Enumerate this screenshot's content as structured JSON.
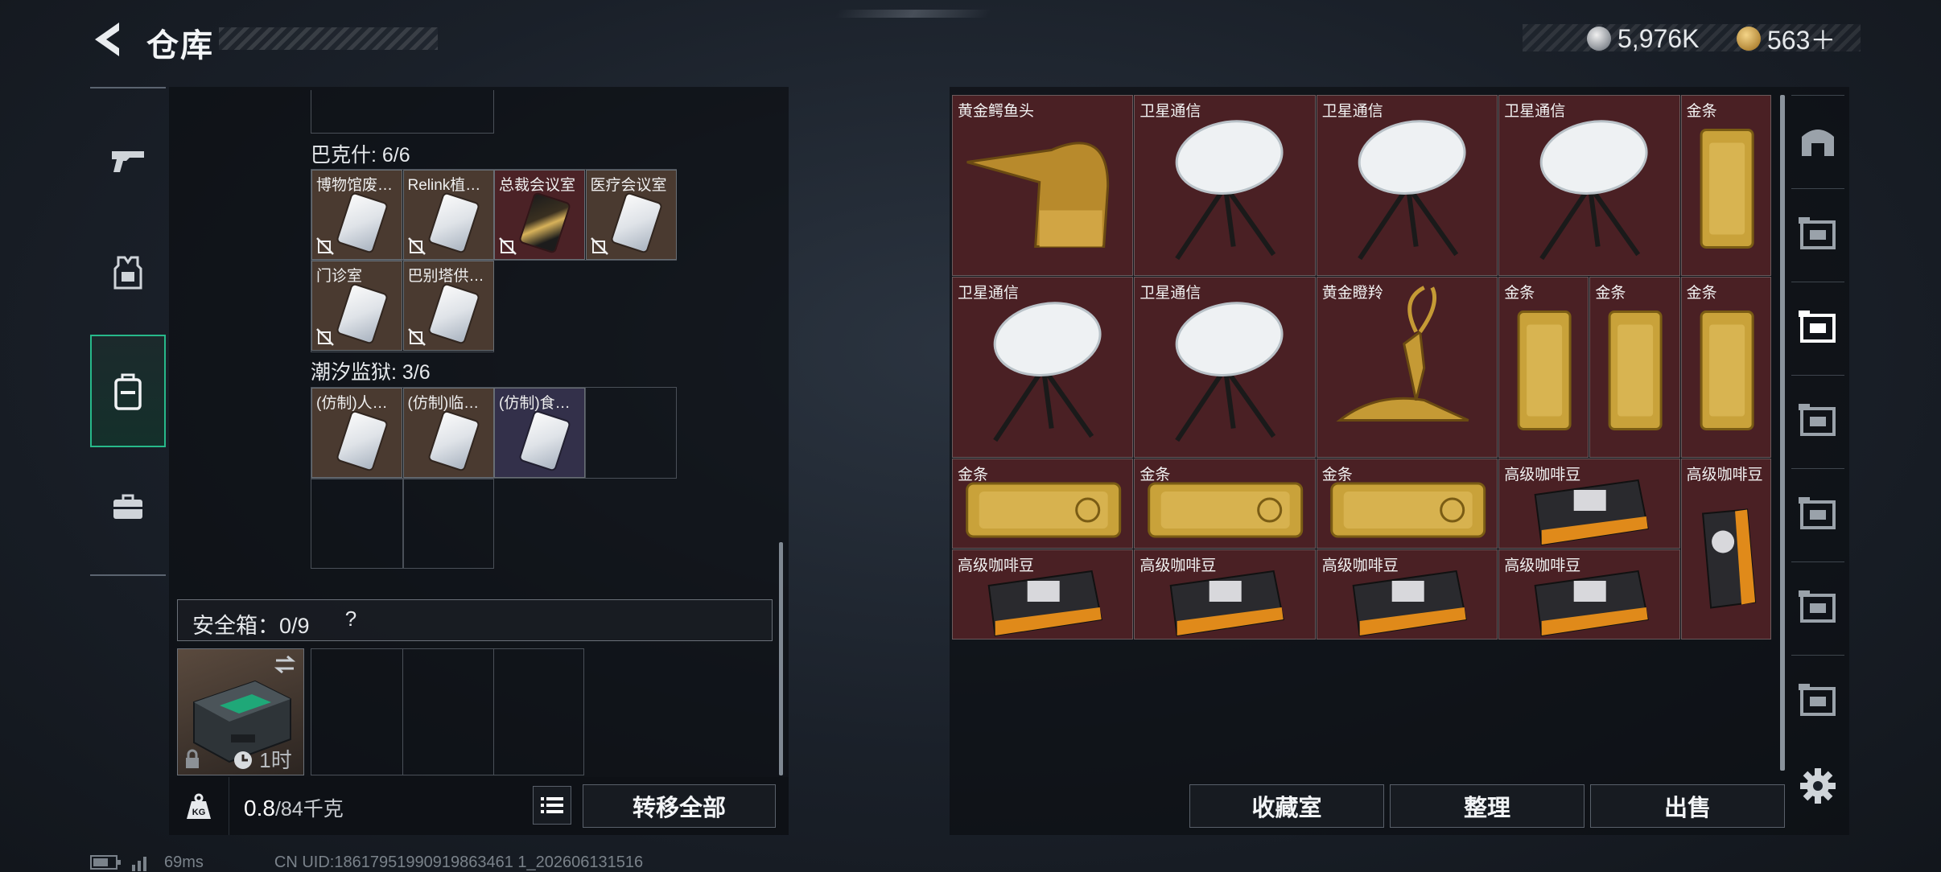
{
  "header": {
    "title": "仓库",
    "currency1": {
      "icon": "silver-coin-icon",
      "value": "5,976K"
    },
    "currency2": {
      "icon": "triangle-coin-icon",
      "value": "563＋"
    }
  },
  "left_nav": [
    {
      "name": "nav-weapons",
      "icon": "pistol-icon",
      "active": false
    },
    {
      "name": "nav-gear",
      "icon": "vest-icon",
      "active": false
    },
    {
      "name": "nav-backpack",
      "icon": "backpack-icon",
      "active": true
    },
    {
      "name": "nav-case",
      "icon": "briefcase-icon",
      "active": false
    }
  ],
  "key_groups": [
    {
      "label": "巴克什: 6/6",
      "items": [
        {
          "label": "博物馆废…",
          "card": "white",
          "bg": "brown"
        },
        {
          "label": "Relink植…",
          "card": "white",
          "bg": "brown"
        },
        {
          "label": "总裁会议室",
          "card": "gold",
          "bg": "maroon"
        },
        {
          "label": "医疗会议室",
          "card": "white",
          "bg": "brown"
        },
        {
          "label": "门诊室",
          "card": "white",
          "bg": "brown"
        },
        {
          "label": "巴别塔供…",
          "card": "white",
          "bg": "brown"
        }
      ]
    },
    {
      "label": "潮汐监狱: 3/6",
      "items": [
        {
          "label": "(仿制)人…",
          "card": "white",
          "bg": "brown"
        },
        {
          "label": "(仿制)临…",
          "card": "white",
          "bg": "brown"
        },
        {
          "label": "(仿制)食…",
          "card": "white",
          "bg": "purple"
        }
      ]
    }
  ],
  "safe_box": {
    "label": "安全箱：0/9",
    "help": "?",
    "timer": "1时"
  },
  "footer_left": {
    "weight_current": "0.8",
    "weight_max": "/84千克",
    "transfer_all": "转移全部"
  },
  "storage_items": [
    {
      "label": "黄金鳄鱼头",
      "kind": "croc"
    },
    {
      "label": "卫星通信",
      "kind": "dish"
    },
    {
      "label": "卫星通信",
      "kind": "dish"
    },
    {
      "label": "卫星通信",
      "kind": "dish"
    },
    {
      "label": "金条",
      "kind": "goldv"
    },
    {
      "label": "卫星通信",
      "kind": "dish"
    },
    {
      "label": "卫星通信",
      "kind": "dish"
    },
    {
      "label": "黄金瞪羚",
      "kind": "gazelle"
    },
    {
      "label": "金条",
      "kind": "goldv"
    },
    {
      "label": "金条",
      "kind": "goldv"
    },
    {
      "label": "金条",
      "kind": "goldv"
    },
    {
      "label": "金条",
      "kind": "goldh"
    },
    {
      "label": "金条",
      "kind": "goldh"
    },
    {
      "label": "金条",
      "kind": "goldh"
    },
    {
      "label": "高级咖啡豆",
      "kind": "coffeeh"
    },
    {
      "label": "高级咖啡豆",
      "kind": "coffeev"
    },
    {
      "label": "高级咖啡豆",
      "kind": "coffeeh"
    },
    {
      "label": "高级咖啡豆",
      "kind": "coffeeh"
    },
    {
      "label": "高级咖啡豆",
      "kind": "coffeeh"
    },
    {
      "label": "高级咖啡豆",
      "kind": "coffeeh"
    }
  ],
  "footer_right": {
    "collection": "收藏室",
    "organize": "整理",
    "sell": "出售"
  },
  "right_nav": [
    "home-icon",
    "container-tier5-icon",
    "container-tier4-icon",
    "container-tier4b-icon",
    "container-tier3-icon",
    "container-warning-icon",
    "container-tier4c-icon"
  ],
  "status": {
    "ping": "69ms",
    "uid": "CN UID:18617951990919863461 1_202606131516"
  },
  "colors": {
    "accent": "#27b98a",
    "item_bg": "#4a2024"
  }
}
